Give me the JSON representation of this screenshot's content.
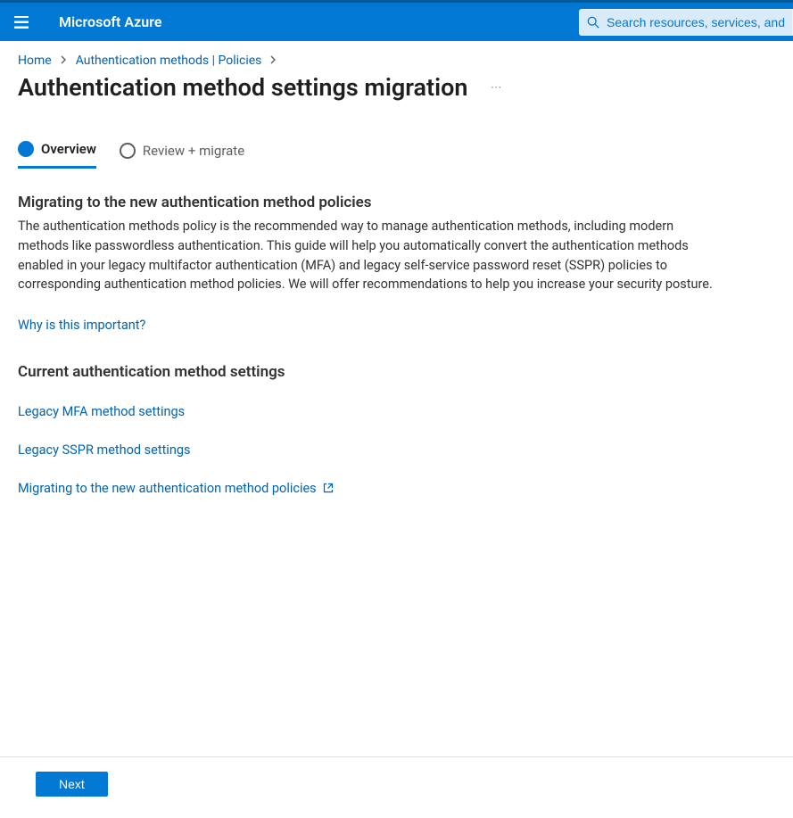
{
  "header": {
    "brand": "Microsoft Azure",
    "search_placeholder": "Search resources, services, and docs (G+/)"
  },
  "breadcrumb": {
    "items": [
      "Home",
      "Authentication methods | Policies"
    ]
  },
  "page": {
    "title": "Authentication method settings migration"
  },
  "tabs": [
    {
      "label": "Overview",
      "active": true
    },
    {
      "label": "Review + migrate",
      "active": false
    }
  ],
  "content": {
    "section1_heading": "Migrating to the new authentication method policies",
    "section1_body": "The authentication methods policy is the recommended way to manage authentication methods, including modern methods like passwordless authentication. This guide will help you automatically convert the authentication methods enabled in your legacy multifactor authentication (MFA) and legacy self-service password reset (SSPR) policies to corresponding authentication method policies. We will offer recommendations to help you increase your security posture.",
    "why_link": "Why is this important?",
    "section2_heading": "Current authentication method settings",
    "links": {
      "legacy_mfa": "Legacy MFA method settings",
      "legacy_sspr": "Legacy SSPR method settings",
      "migrating": "Migrating to the new authentication method policies"
    }
  },
  "footer": {
    "next": "Next"
  }
}
